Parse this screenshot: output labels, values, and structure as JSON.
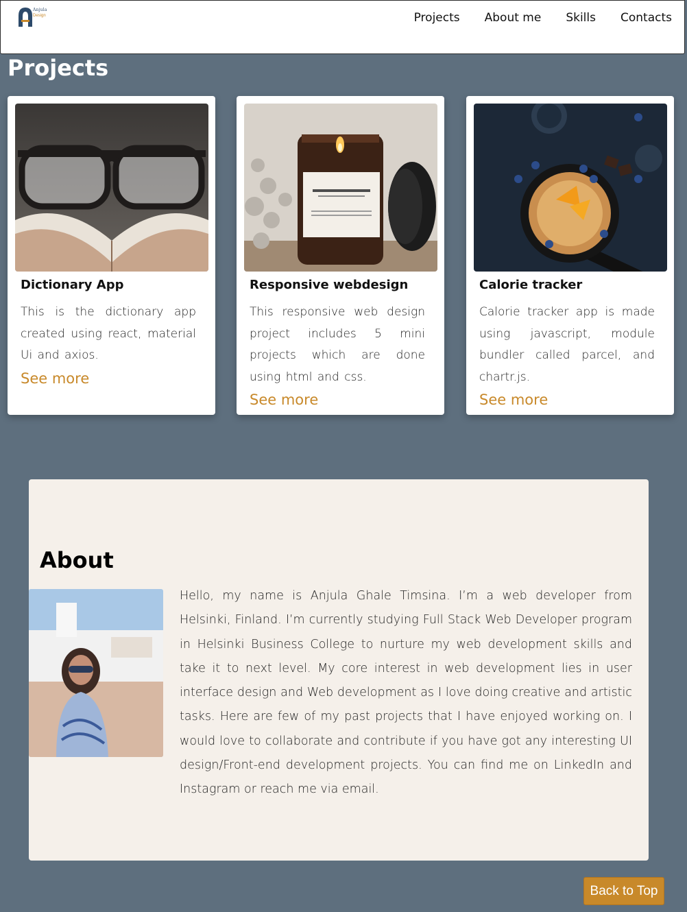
{
  "brand": {
    "logo_word1": "Anjula",
    "logo_word2": "Design"
  },
  "nav": {
    "items": [
      "Projects",
      "About me",
      "Skills",
      "Contacts"
    ]
  },
  "projects": {
    "title": "Projects",
    "cards": [
      {
        "title": "Dictionary App",
        "desc": "This is the dictionary app created using react, material Ui and axios.",
        "link": "See more",
        "image": "glasses-on-book-photo"
      },
      {
        "title": "Responsive webdesign",
        "desc": "This responsive web design project includes 5 mini projects which are done using html and css.",
        "link": "See more",
        "image": "smokey-wood-candle-photo"
      },
      {
        "title": "Calorie tracker",
        "desc": "Calorie tracker app is made using javascript, module bundler called parcel, and chartr.js.",
        "link": "See more",
        "image": "pancakes-skillet-photo"
      }
    ]
  },
  "about": {
    "title": "About",
    "text": "Hello, my name is Anjula Ghale Timsina. I’m a web developer from Helsinki, Finland. I’m currently studying Full Stack Web Developer program in Helsinki Business College to nurture my web development skills and take it to next level. My core interest in web development lies in user interface design and Web development as I love doing creative and artistic tasks. Here are few of my past projects that I have enjoyed working on. I would love to collaborate and contribute if you have got any interesting UI design/Front-end development projects. You can find me on LinkedIn and Instagram or reach me via email.",
    "photo": "profile-photo"
  },
  "back_to_top": "Back to Top",
  "colors": {
    "accent": "#c8892a",
    "page_bg": "#5e6f7e",
    "about_bg": "#f5f0ea",
    "brand_blue": "#2d4a6a"
  }
}
